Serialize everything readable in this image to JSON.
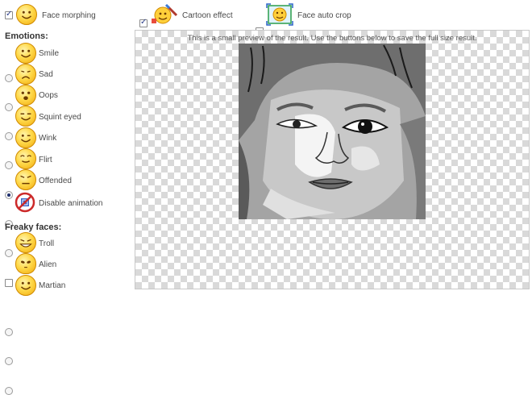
{
  "top_options": [
    {
      "label": "Face morphing",
      "checked": true,
      "icon": "smiley-icon"
    },
    {
      "label": "Cartoon effect",
      "checked": true,
      "icon": "cartoon-brush-icon"
    },
    {
      "label": "Face auto crop",
      "checked": false,
      "icon": "face-crop-icon"
    }
  ],
  "emotions": {
    "title": "Emotions:",
    "items": [
      {
        "label": "Smile",
        "selected": false
      },
      {
        "label": "Sad",
        "selected": false
      },
      {
        "label": "Oops",
        "selected": false
      },
      {
        "label": "Squint eyed",
        "selected": false
      },
      {
        "label": "Wink",
        "selected": true
      },
      {
        "label": "Flirt",
        "selected": false
      },
      {
        "label": "Offended",
        "selected": false
      }
    ],
    "disable_animation": {
      "label": "Disable animation",
      "checked": false
    }
  },
  "freaky": {
    "title": "Freaky faces:",
    "items": [
      {
        "label": "Troll",
        "selected": false
      },
      {
        "label": "Alien",
        "selected": false
      },
      {
        "label": "Martian",
        "selected": false
      }
    ]
  },
  "preview": {
    "caption": "This is a small preview of the result. Use the buttons below to save the full size result."
  }
}
